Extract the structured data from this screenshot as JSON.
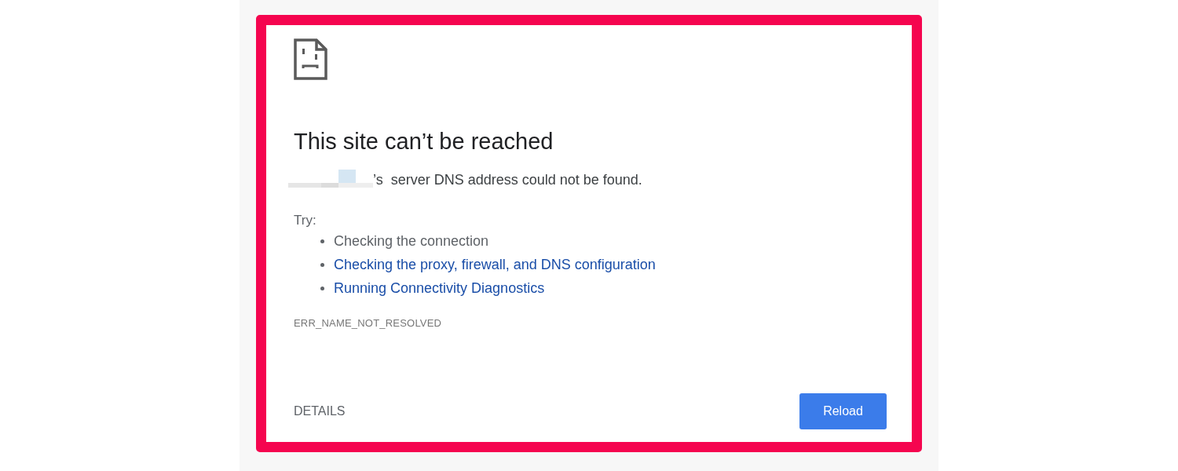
{
  "error_page": {
    "title": "This site can’t be reached",
    "message": {
      "redacted_host": true,
      "text": "’s  server DNS address could not be found."
    },
    "try_label": "Try:",
    "suggestions": [
      {
        "kind": "text",
        "label": "Checking the connection"
      },
      {
        "kind": "link",
        "label": "Checking the proxy, firewall, and DNS configuration"
      },
      {
        "kind": "link",
        "label": "Running Connectivity Diagnostics"
      }
    ],
    "error_code": "ERR_NAME_NOT_RESOLVED",
    "details_button": "DETAILS",
    "reload_button": "Reload"
  }
}
